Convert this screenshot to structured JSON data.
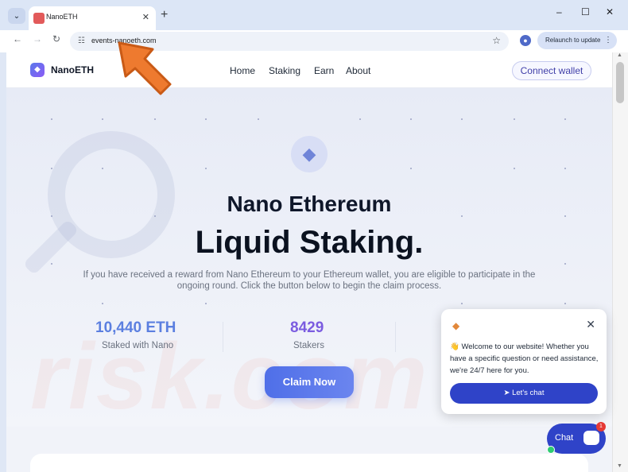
{
  "browser": {
    "tab_title": "NanoETH",
    "url": "events-nanoeth.com",
    "relaunch_label": "Relaunch to update",
    "window_controls": [
      "minimize-icon",
      "maximize-icon",
      "close-icon"
    ]
  },
  "site": {
    "brand": "NanoETH",
    "nav": [
      "Home",
      "Staking",
      "Earn",
      "About"
    ],
    "connect_label": "Connect wallet",
    "hero": {
      "subtitle": "Nano Ethereum",
      "title": "Liquid Staking.",
      "description": "If you have received a reward from Nano Ethereum to your Ethereum wallet, you are eligible to participate in the ongoing round. Click the button below to begin the claim process."
    },
    "stats": [
      {
        "value": "10,440 ETH",
        "label": "Staked with Nano",
        "color": "#5b7fe0"
      },
      {
        "value": "8429",
        "label": "Stakers",
        "color": "#7b5ce0"
      }
    ],
    "claim_label": "Claim Now",
    "watermark": "risk.com"
  },
  "chat": {
    "message": "👋 Welcome to our website! Whether you have a specific question or need assistance, we're 24/7 here for you.",
    "button_label": "Let's chat",
    "fab_label": "Chat",
    "badge_count": "1"
  },
  "colors": {
    "accent": "#4f6fe8",
    "chat_blue": "#2f43c8",
    "arrow": "#ee7a2f"
  }
}
